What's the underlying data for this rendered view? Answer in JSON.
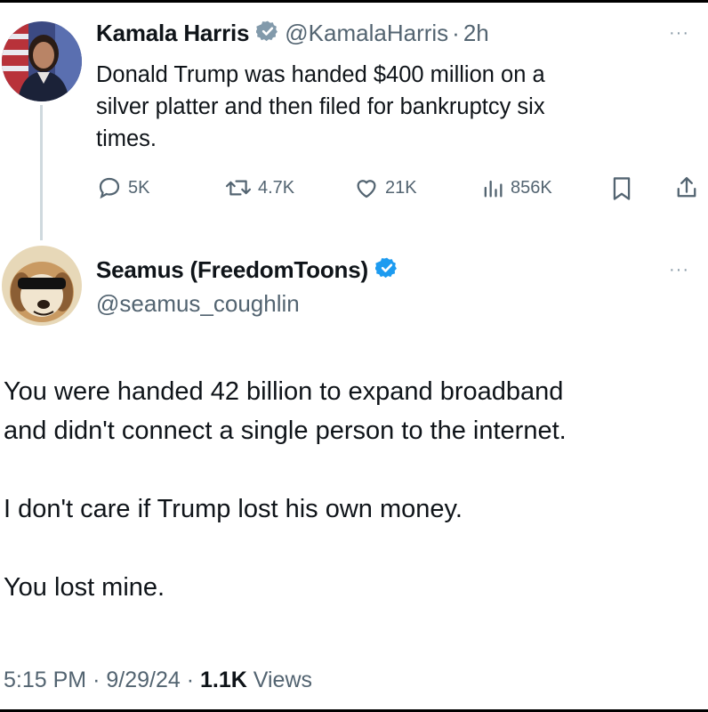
{
  "original_tweet": {
    "author_name": "Kamala Harris",
    "handle": "@KamalaHarris",
    "separator": "·",
    "time_ago": "2h",
    "text_lines": [
      "Donald Trump was handed $400 million on a",
      "silver platter and then filed for bankruptcy six",
      "times."
    ],
    "actions": {
      "replies": "5K",
      "retweets": "4.7K",
      "likes": "21K",
      "views": "856K"
    },
    "more_label": "···"
  },
  "reply_tweet": {
    "author_name": "Seamus (FreedomToons)",
    "handle": "@seamus_coughlin",
    "more_label": "···",
    "paragraphs": [
      "You were handed 42 billion to expand broadband",
      "and didn't connect a single person to the internet.",
      "I don't care if Trump lost his own money.",
      "You lost mine."
    ],
    "meta": {
      "time": "5:15 PM",
      "date": "9/29/24",
      "separator": "·",
      "view_count": "1.1K",
      "views_label": "Views"
    }
  },
  "colors": {
    "verified_blue": "#1d9bf0",
    "secondary_text": "#536471",
    "primary_text": "#0f1419"
  }
}
